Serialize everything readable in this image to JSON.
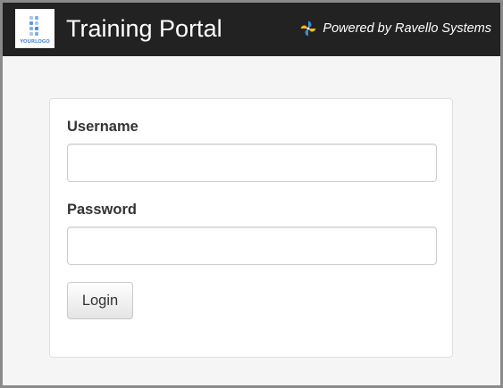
{
  "header": {
    "logo_text": "YOURLOGO",
    "title": "Training Portal",
    "powered_by": "Powered by Ravello Systems"
  },
  "login_form": {
    "username_label": "Username",
    "username_value": "",
    "password_label": "Password",
    "password_value": "",
    "login_label": "Login"
  },
  "colors": {
    "header_background": "#222222",
    "page_background": "#f5f5f5",
    "card_background": "#ffffff",
    "pinwheel_blue": "#3a8fd6",
    "pinwheel_yellow": "#f2b81c"
  },
  "icons": {
    "logo": "your-logo-placeholder-icon",
    "ravello": "ravello-pinwheel-icon"
  }
}
